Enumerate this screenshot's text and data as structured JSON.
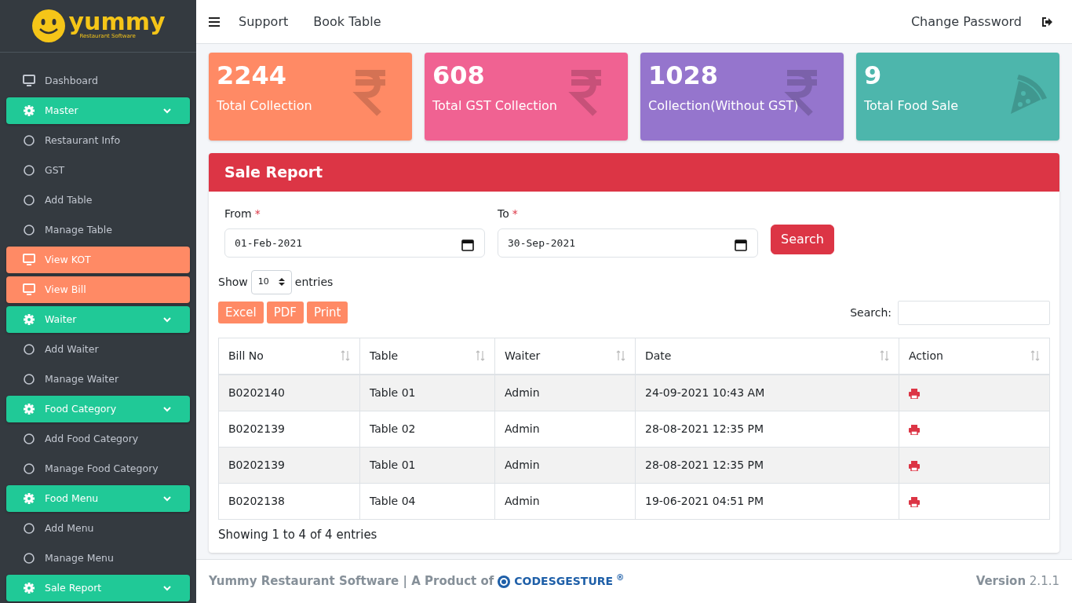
{
  "sidebar": {
    "logo": {
      "word": "yummy",
      "tagline": "Restaurant Software"
    },
    "items": [
      {
        "kind": "plain",
        "label": "Dashboard"
      },
      {
        "kind": "group",
        "label": "Master",
        "expanded": true
      },
      {
        "kind": "child",
        "label": "Restaurant Info"
      },
      {
        "kind": "child",
        "label": "GST"
      },
      {
        "kind": "child",
        "label": "Add Table"
      },
      {
        "kind": "child",
        "label": "Manage Table"
      },
      {
        "kind": "accent",
        "label": "View KOT"
      },
      {
        "kind": "accent",
        "label": "View Bill"
      },
      {
        "kind": "group",
        "label": "Waiter",
        "expanded": true
      },
      {
        "kind": "child",
        "label": "Add Waiter"
      },
      {
        "kind": "child",
        "label": "Manage Waiter"
      },
      {
        "kind": "group",
        "label": "Food Category",
        "expanded": true
      },
      {
        "kind": "child",
        "label": "Add Food Category"
      },
      {
        "kind": "child",
        "label": "Manage Food Category"
      },
      {
        "kind": "group",
        "label": "Food Menu",
        "expanded": true
      },
      {
        "kind": "child",
        "label": "Add Menu"
      },
      {
        "kind": "child",
        "label": "Manage Menu"
      },
      {
        "kind": "group",
        "label": "Sale Report",
        "expanded": true
      }
    ]
  },
  "navbar": {
    "links": [
      "Support",
      "Book Table"
    ],
    "right_link": "Change Password"
  },
  "stats": [
    {
      "value": "2244",
      "label": "Total Collection",
      "color": "#ff8a65",
      "kind": "currency"
    },
    {
      "value": "608",
      "label": "Total GST Collection",
      "color": "#f06292",
      "kind": "currency"
    },
    {
      "value": "1028",
      "label": "Collection(Without GST)",
      "color": "#9575cd",
      "kind": "currency"
    },
    {
      "value": "9",
      "label": "Total Food Sale",
      "color": "#4db6ac",
      "kind": "food"
    }
  ],
  "report": {
    "title": "Sale Report",
    "fields": [
      {
        "label": "From",
        "required_mark": "*",
        "value": "01-Feb-2021"
      },
      {
        "label": "To",
        "required_mark": "*",
        "value": "30-Sep-2021"
      }
    ],
    "search_button": "Search",
    "length": {
      "before": "Show",
      "value": "10",
      "after": "entries"
    },
    "export_buttons": [
      "Excel",
      "PDF",
      "Print"
    ],
    "search_label": "Search:",
    "table": {
      "columns": [
        "Bill No",
        "Table",
        "Waiter",
        "Date",
        "Action"
      ],
      "rows": [
        [
          "B0202140",
          "Table 01",
          "Admin",
          "24-09-2021 10:43 AM"
        ],
        [
          "B0202139",
          "Table 02",
          "Admin",
          "28-08-2021 12:35 PM"
        ],
        [
          "B0202139",
          "Table 01",
          "Admin",
          "28-08-2021 12:35 PM"
        ],
        [
          "B0202138",
          "Table 04",
          "Admin",
          "19-06-2021 04:51 PM"
        ]
      ]
    },
    "info": "Showing 1 to 4 of 4 entries"
  },
  "footer": {
    "text": "Yummy Restaurant Software | A Product of",
    "brand": "CODESGESTURE",
    "brand_mark": "®",
    "version": "**Version** 2.1.1"
  }
}
